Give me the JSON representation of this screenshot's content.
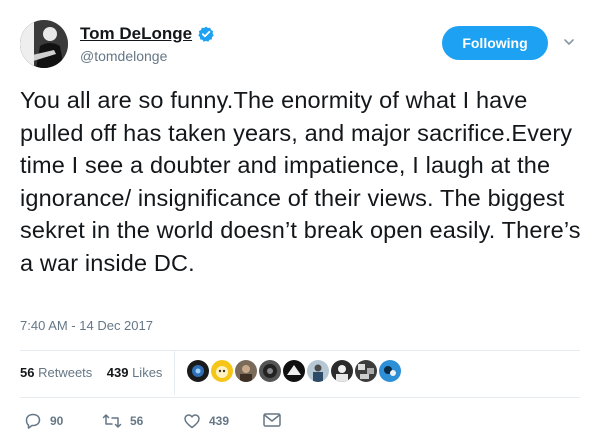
{
  "user": {
    "display_name": "Tom DeLonge",
    "handle": "@tomdelonge",
    "verified": true
  },
  "header": {
    "follow_button_label": "Following",
    "caret_icon": "chevron-down-icon"
  },
  "tweet": {
    "text": "You all are so funny.The enormity of what I have pulled off has taken years, and major sacrifice.Every time I see a doubter and impatience, I laugh at the ignorance/ insignificance of their views. The biggest sekret in the world doesn’t break open easily. There’s a war inside DC.",
    "timestamp": "7:40 AM - 14 Dec 2017"
  },
  "stats": {
    "retweets_count": "56",
    "retweets_label": "Retweets",
    "likes_count": "439",
    "likes_label": "Likes",
    "liker_avatars": 9
  },
  "actions": {
    "replies": "90",
    "retweets": "56",
    "likes": "439"
  },
  "colors": {
    "accent": "#1da1f2",
    "muted": "#657786",
    "text": "#14171a"
  }
}
